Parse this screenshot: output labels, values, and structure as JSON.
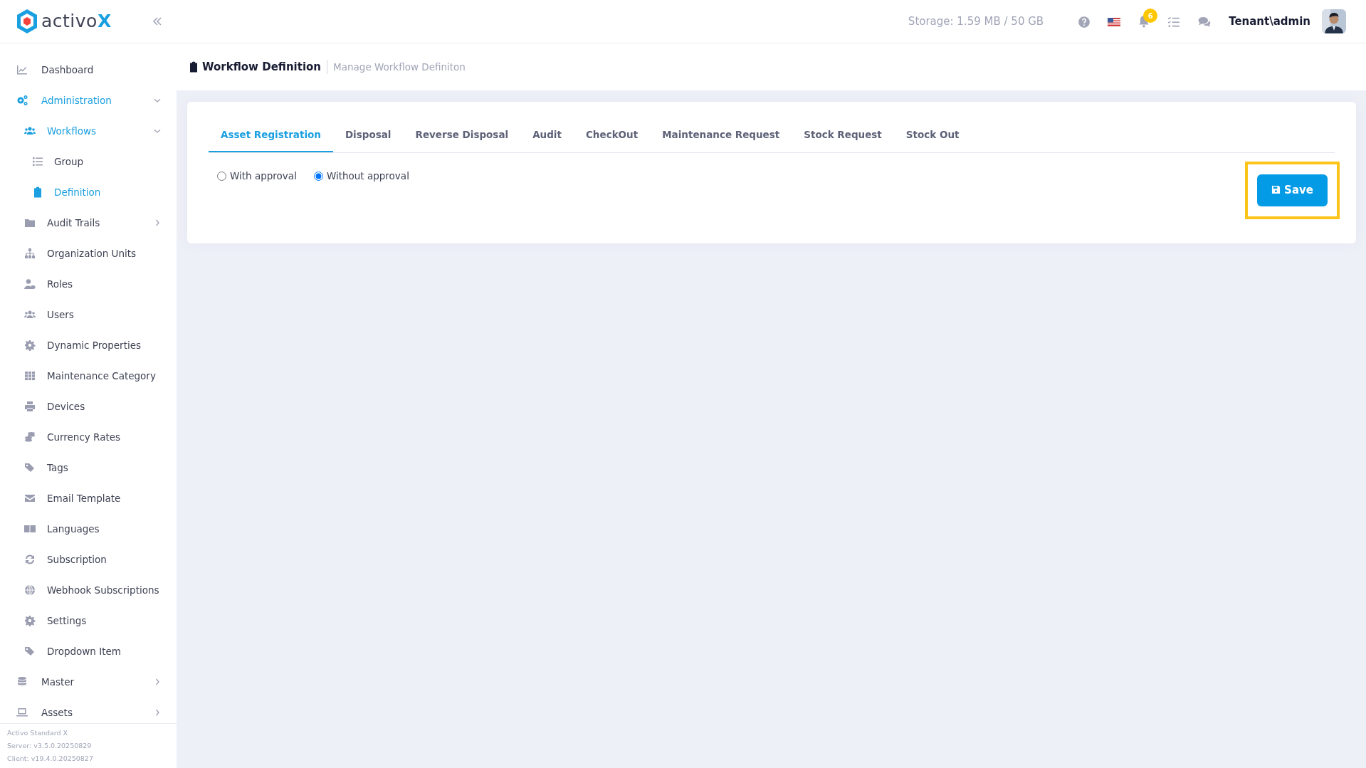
{
  "logo": {
    "text": "activo",
    "accent": "X"
  },
  "sidebar": {
    "items": [
      {
        "label": "Dashboard",
        "selected": false
      },
      {
        "label": "Administration",
        "selected": true,
        "expanded": true,
        "children": [
          {
            "label": "Workflows",
            "selected": true,
            "expanded": true,
            "children": [
              {
                "label": "Group",
                "selected": false
              },
              {
                "label": "Definition",
                "selected": true
              }
            ]
          },
          {
            "label": "Audit Trails",
            "selected": false,
            "expanded": false
          },
          {
            "label": "Organization Units",
            "selected": false
          },
          {
            "label": "Roles",
            "selected": false
          },
          {
            "label": "Users",
            "selected": false
          },
          {
            "label": "Dynamic Properties",
            "selected": false
          },
          {
            "label": "Maintenance Category",
            "selected": false
          },
          {
            "label": "Devices",
            "selected": false
          },
          {
            "label": "Currency Rates",
            "selected": false
          },
          {
            "label": "Tags",
            "selected": false
          },
          {
            "label": "Email Template",
            "selected": false
          },
          {
            "label": "Languages",
            "selected": false
          },
          {
            "label": "Subscription",
            "selected": false
          },
          {
            "label": "Webhook Subscriptions",
            "selected": false
          },
          {
            "label": "Settings",
            "selected": false
          },
          {
            "label": "Dropdown Item",
            "selected": false
          }
        ]
      },
      {
        "label": "Master",
        "selected": false,
        "expanded": false
      },
      {
        "label": "Assets",
        "selected": false,
        "expanded": false
      }
    ],
    "footer": [
      "Activo Standard X",
      "Server: v3.5.0.20250829",
      "Client: v19.4.0.20250827"
    ]
  },
  "topbar": {
    "storage": "Storage: 1.59 MB / 50 GB",
    "notification_count": "6",
    "user": "Tenant\\admin"
  },
  "page_header": {
    "title": "Workflow Definition",
    "subtitle": "Manage Workflow Definiton"
  },
  "tabs": [
    {
      "label": "Asset Registration",
      "selected": true
    },
    {
      "label": "Disposal",
      "selected": false
    },
    {
      "label": "Reverse Disposal",
      "selected": false
    },
    {
      "label": "Audit",
      "selected": false
    },
    {
      "label": "CheckOut",
      "selected": false
    },
    {
      "label": "Maintenance Request",
      "selected": false
    },
    {
      "label": "Stock Request",
      "selected": false
    },
    {
      "label": "Stock Out",
      "selected": false
    }
  ],
  "options": [
    {
      "label": "With approval",
      "checked": false
    },
    {
      "label": "Without approval",
      "checked": true
    }
  ],
  "save_button": {
    "label": "Save",
    "highlighted": true
  }
}
